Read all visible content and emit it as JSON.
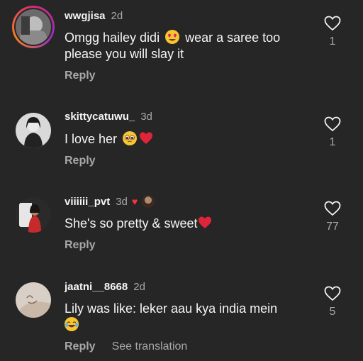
{
  "comments": [
    {
      "username": "wwgjisa",
      "time": "2d",
      "text_before": "Omgg hailey didi",
      "emoji_1": "heart-eyes-emoji",
      "text_after": "wear a saree too please you will slay it",
      "reply": "Reply",
      "likes": "1"
    },
    {
      "username": "skittycatuwu_",
      "time": "3d",
      "text_before": "I love her",
      "emoji_1": "pleading-face-emoji",
      "emoji_2": "red-heart-emoji",
      "reply": "Reply",
      "likes": "1"
    },
    {
      "username": "viiiiii_pvt",
      "time": "3d",
      "text_before": "She's so pretty & sweet",
      "emoji_1": "red-heart-emoji",
      "reply": "Reply",
      "likes": "77"
    },
    {
      "username": "jaatni__8668",
      "time": "2d",
      "text_before": "Lily was like: leker aau kya india mein",
      "emoji_1": "joy-emoji",
      "reply": "Reply",
      "translate": "See translation",
      "likes": "5"
    }
  ],
  "colors": {
    "background": "#262626",
    "primary_text": "#f5f5f5",
    "secondary_text": "#a8a8a8",
    "heart_red": "#ff3040"
  }
}
